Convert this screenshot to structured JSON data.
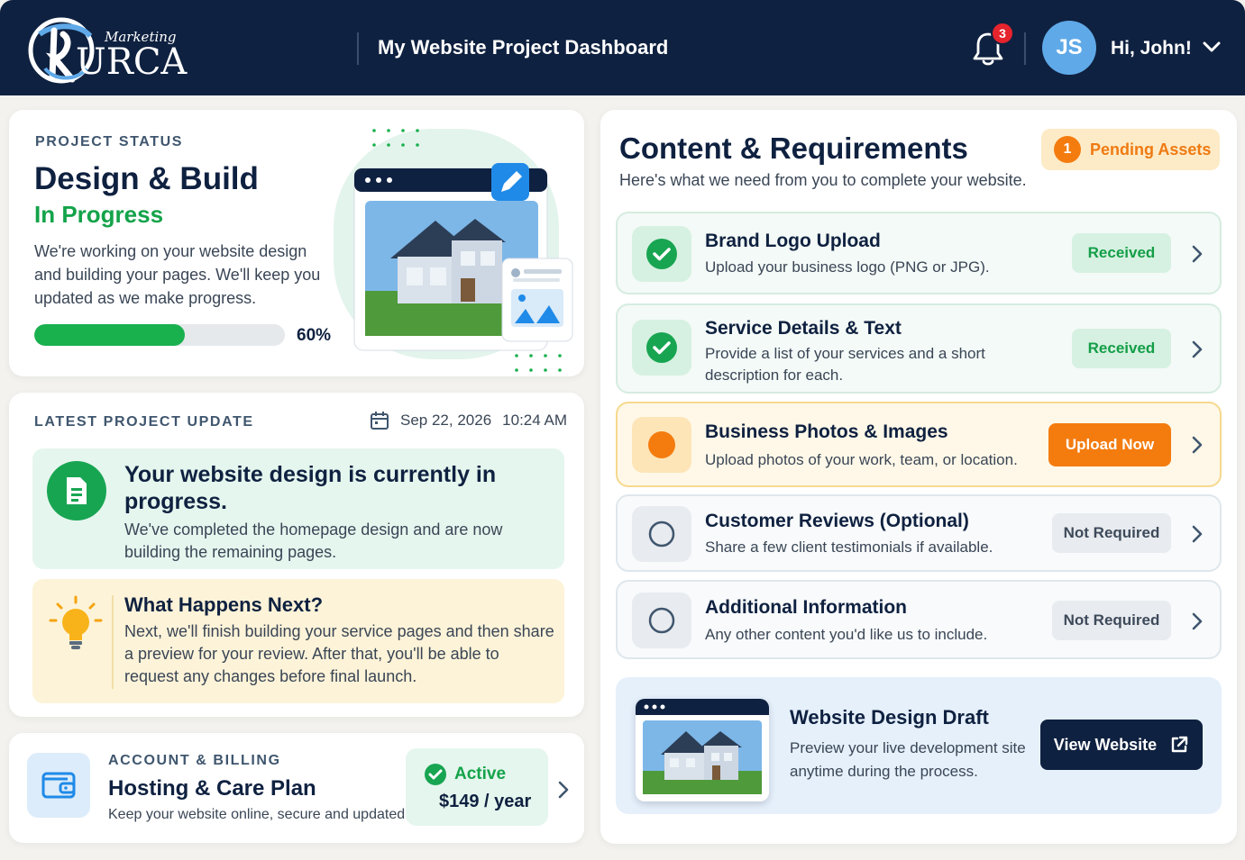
{
  "header": {
    "logo_small": "Marketing",
    "logo_big": "URCA",
    "title": "My Website Project Dashboard",
    "notification_count": "3",
    "avatar_initials": "JS",
    "greeting": "Hi, John!"
  },
  "project_status": {
    "label": "PROJECT STATUS",
    "title": "Design & Build",
    "status": "In Progress",
    "description": "We're working on your website design and building your pages. We'll keep you updated as we make progress.",
    "progress": 0.6,
    "progress_label": "60%"
  },
  "latest_update": {
    "label": "LATEST PROJECT UPDATE",
    "date": "Sep 22, 2026",
    "time": "10:24 AM",
    "update_title": "Your website design is currently in progress.",
    "update_desc": "We've completed the homepage design and are now building the remaining pages.",
    "next_title": "What Happens Next?",
    "next_desc": "Next, we'll finish building your service pages and then share a preview for your review. After that, you'll be able to request any changes before final launch."
  },
  "billing": {
    "label": "ACCOUNT & BILLING",
    "title": "Hosting & Care Plan",
    "description": "Keep your website online, secure and updated.",
    "status": "Active",
    "price": "$149 / year"
  },
  "content": {
    "title": "Content & Requirements",
    "subtitle": "Here's what we need from you to complete your website.",
    "pending_count": "1",
    "pending_label": "Pending Assets",
    "items": [
      {
        "title": "Brand Logo Upload",
        "desc": "Upload your business logo (PNG or JPG).",
        "status": "Received"
      },
      {
        "title": "Service Details & Text",
        "desc": "Provide a list of your services and a short description for each.",
        "status": "Received"
      },
      {
        "title": "Business Photos & Images",
        "desc": "Upload photos of your work, team, or location.",
        "status": "Upload Now"
      },
      {
        "title": "Customer Reviews (Optional)",
        "desc": "Share a few client testimonials if available.",
        "status": "Not Required"
      },
      {
        "title": "Additional Information",
        "desc": "Any other content you'd like us to include.",
        "status": "Not Required"
      }
    ],
    "draft": {
      "title": "Website Design Draft",
      "desc": "Preview your live development site anytime during the process.",
      "button": "View Website"
    }
  },
  "colors": {
    "navy": "#0f2140",
    "green": "#19b04e",
    "orange": "#f47c0f",
    "badge_red": "#e5242d"
  }
}
